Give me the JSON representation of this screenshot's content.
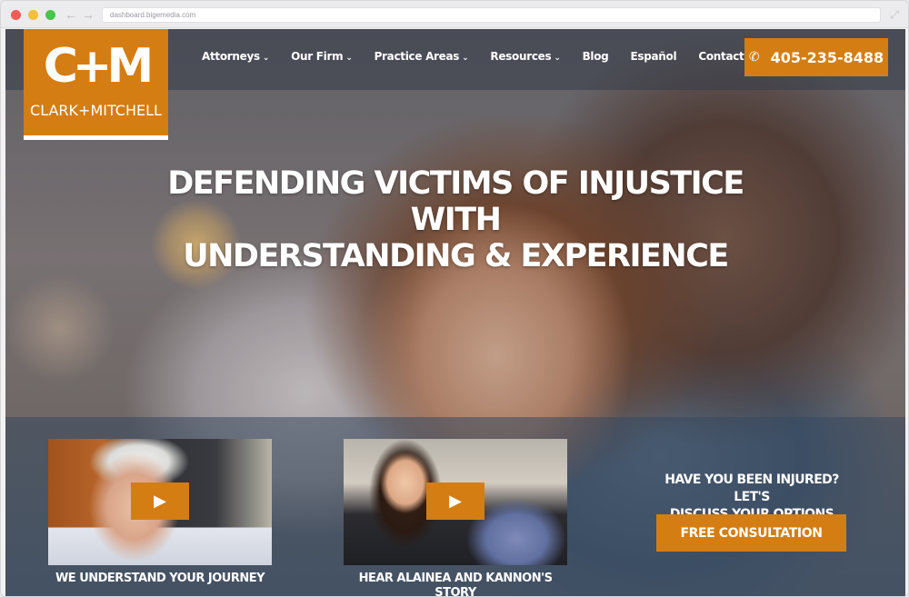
{
  "browser": {
    "url": "dashboard.bigemedia.com"
  },
  "logo": {
    "mark": "C+M",
    "name": "CLARK+MITCHELL"
  },
  "nav": {
    "items": [
      {
        "label": "Attorneys",
        "has_dropdown": true
      },
      {
        "label": "Our Firm",
        "has_dropdown": true
      },
      {
        "label": "Practice Areas",
        "has_dropdown": true
      },
      {
        "label": "Resources",
        "has_dropdown": true
      },
      {
        "label": "Blog",
        "has_dropdown": false
      },
      {
        "label": "Español",
        "has_dropdown": false
      },
      {
        "label": "Contact Us",
        "has_dropdown": false
      }
    ],
    "dropdown_icon": "chevron-down-icon"
  },
  "phone": {
    "number": "405-235-8488",
    "icon": "phone-icon"
  },
  "hero": {
    "headline_line1": "DEFENDING VICTIMS OF INJUSTICE WITH",
    "headline_line2": "UNDERSTANDING & EXPERIENCE"
  },
  "videos": [
    {
      "caption": "WE UNDERSTAND YOUR JOURNEY",
      "icon": "play-icon"
    },
    {
      "caption": "HEAR ALAINEA AND KANNON'S STORY",
      "icon": "play-icon"
    }
  ],
  "cta": {
    "line1": "HAVE YOU BEEN INJURED? LET'S",
    "line2": "DISCUSS YOUR OPTIONS",
    "button_label": "FREE CONSULTATION"
  },
  "colors": {
    "accent": "#d47d12",
    "text": "#ffffff"
  }
}
